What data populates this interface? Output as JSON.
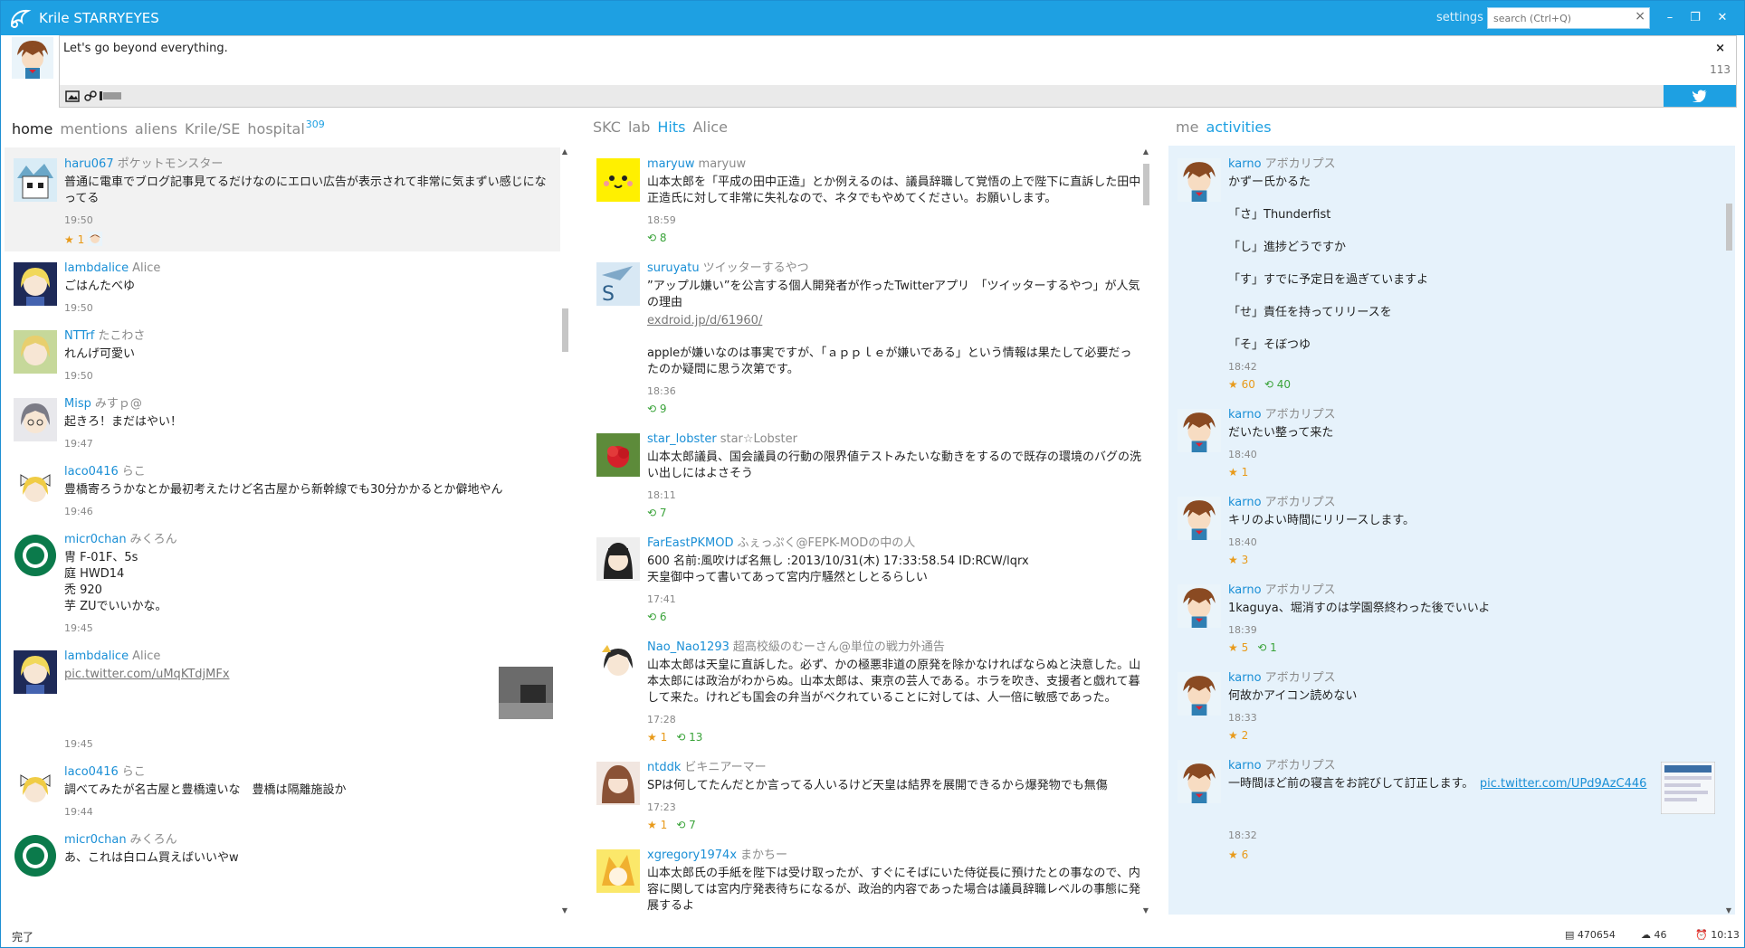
{
  "titlebar": {
    "app_title": "Krile STARRYEYES",
    "settings_label": "settings",
    "search_placeholder": "search (Ctrl+Q)",
    "search_clear": "×",
    "minimize": "–",
    "restore": "❐",
    "close": "✕"
  },
  "composer": {
    "text": "Let's go beyond everything.",
    "close": "×",
    "remaining": "113"
  },
  "colors": {
    "accent": "#1ea0e2",
    "screen_name": "#1a8fd6",
    "favorite": "#e89a1a",
    "retweet": "#3aa33a",
    "activity_background": "#e6f2fb"
  },
  "col1": {
    "tabs": [
      "home",
      "mentions",
      "aliens",
      "Krile/SE",
      "hospital"
    ],
    "hospital_count": "309",
    "statuses": [
      {
        "screen_name": "haru067",
        "user_name": "ポケットモンスター",
        "text": "普通に電車でブログ記事見てるだけなのにエロい広告が表示されて非常に気まずい感じになってる",
        "time": "19:50",
        "favs": "1"
      },
      {
        "screen_name": "lambdalice",
        "user_name": "Alice",
        "text": "ごはんたべゆ",
        "time": "19:50"
      },
      {
        "screen_name": "NTTrf",
        "user_name": "たこわさ",
        "text": "れんげ可愛い",
        "time": "19:50"
      },
      {
        "screen_name": "Misp",
        "user_name": "みすｐ@",
        "text": "起きろ！まだはやい！",
        "time": "19:47"
      },
      {
        "screen_name": "laco0416",
        "user_name": "らこ",
        "text": "豊橋寄ろうかなとか最初考えたけど名古屋から新幹線でも30分かかるとか僻地やん",
        "time": "19:46"
      },
      {
        "screen_name": "micr0chan",
        "user_name": "みくろん",
        "text": "冑 F-01F、5s\n庭 HWD14\n禿 920\n芋 ZUでいいかな。",
        "time": "19:45"
      },
      {
        "screen_name": "lambdalice",
        "user_name": "Alice",
        "link": "pic.twitter.com/uMqKTdjMFx",
        "time": "19:45"
      },
      {
        "screen_name": "laco0416",
        "user_name": "らこ",
        "text": "調べてみたが名古屋と豊橋遠いな　豊橋は隔離施設か",
        "time": "19:44"
      },
      {
        "screen_name": "micr0chan",
        "user_name": "みくろん",
        "text": "あ、これは白ロム買えばいいやw",
        "time": ""
      }
    ]
  },
  "col2": {
    "tabs": [
      "SKC",
      "lab",
      "Hits",
      "Alice"
    ],
    "statuses": [
      {
        "screen_name": "maryuw",
        "user_name": "maryuw",
        "text": "山本太郎を「平成の田中正造」とか例えるのは、議員辞職して覚悟の上で陛下に直訴した田中正造氏に対して非常に失礼なので、ネタでもやめてください。お願いします。",
        "time": "18:59",
        "rts": "8"
      },
      {
        "screen_name": "suruyatu",
        "user_name": "ツイッターするやつ",
        "text": "”アップル嫌い”を公言する個人開発者が作ったTwitterアプリ　「ツイッターするやつ」が人気の理由",
        "link": "exdroid.jp/d/61960/",
        "text2": "appleが嫌いなのは事実ですが、「ａｐｐｌｅが嫌いである」という情報は果たして必要だったのか疑問に思う次第です。",
        "time": "18:36",
        "rts": "9"
      },
      {
        "screen_name": "star_lobster",
        "user_name": "star☆Lobster",
        "text": "山本太郎議員、国会議員の行動の限界値テストみたいな動きをするので既存の環境のバグの洗い出しにはよさそう",
        "time": "18:11",
        "rts": "7"
      },
      {
        "screen_name": "FarEastPKMOD",
        "user_name": "ふぇっぷく@FEPK-MODの中の人",
        "text": "600 名前:風吹けば名無し :2013/10/31(木) 17:33:58.54 ID:RCW/lqrx\n天皇御中って書いてあって宮内庁騒然としとるらしい",
        "time": "17:41",
        "rts": "6"
      },
      {
        "screen_name": "Nao_Nao1293",
        "user_name": "超高校級のむーさん@単位の戦力外通告",
        "text": "山本太郎は天皇に直訴した。必ず、かの極悪非道の原発を除かなければならぬと決意した。山本太郎には政治がわからぬ。山本太郎は、東京の芸人である。ホラを吹き、支援者と戯れて暮して来た。けれども国会の弁当がベクれていることに対しては、人一倍に敏感であった。",
        "time": "17:28",
        "favs": "1",
        "rts": "13"
      },
      {
        "screen_name": "ntddk",
        "user_name": "ビキニアーマー",
        "text": "SPは何してたんだとか言ってる人いるけど天皇は結界を展開できるから爆発物でも無傷",
        "time": "17:23",
        "favs": "1",
        "rts": "7"
      },
      {
        "screen_name": "xgregory1974x",
        "user_name": "まかちー",
        "text": "山本太郎氏の手紙を陛下は受け取ったが、すぐにそばにいた侍従長に預けたとの事なので、内容に関しては宮内庁発表待ちになるが、政治的内容であった場合は議員辞職レベルの事態に発展するよ",
        "time": ""
      }
    ]
  },
  "col3": {
    "tabs": [
      "me",
      "activities"
    ],
    "statuses": [
      {
        "screen_name": "karno",
        "user_name": "アボカリプス",
        "text": "かずー氏かるた\n\n「さ」Thunderfist\n\n「し」進捗どうですか\n\n「す」すでに予定日を過ぎていますよ\n\n「せ」責任を持ってリリースを\n\n「そ」そぼつゆ",
        "time": "18:42",
        "favs": "60",
        "rts": "40"
      },
      {
        "screen_name": "karno",
        "user_name": "アボカリプス",
        "text": "だいたい整って来た",
        "time": "18:40",
        "favs": "1"
      },
      {
        "screen_name": "karno",
        "user_name": "アボカリプス",
        "text": "キリのよい時間にリリースします。",
        "time": "18:40",
        "favs": "3"
      },
      {
        "screen_name": "karno",
        "user_name": "アボカリプス",
        "text": "1kaguya、堀消すのは学園祭終わった後でいいよ",
        "time": "18:39",
        "favs": "5",
        "rts": "1"
      },
      {
        "screen_name": "karno",
        "user_name": "アボカリプス",
        "text": "何故かアイコン読めない",
        "time": "18:33",
        "favs": "2"
      },
      {
        "screen_name": "karno",
        "user_name": "アボカリプス",
        "text": "一時間ほど前の寝言をお詫びして訂正します。",
        "link": "pic.twitter.com/UPd9AzC446",
        "time": "18:32",
        "favs": "6"
      }
    ]
  },
  "statusbar": {
    "text": "完了",
    "memory": "470654",
    "api": "46",
    "clock": "10:13"
  }
}
